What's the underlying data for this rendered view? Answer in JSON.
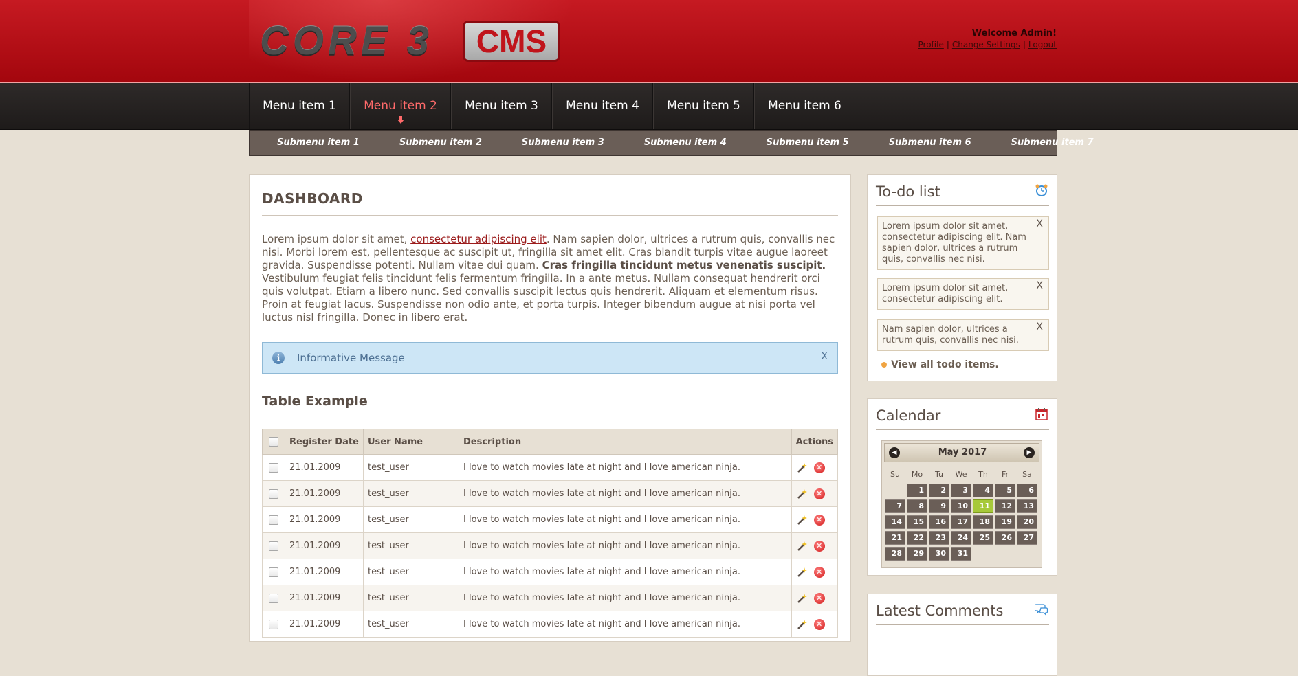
{
  "header": {
    "logo_main": "CORE 3",
    "logo_badge": "CMS",
    "welcome": "Welcome Admin!",
    "links": [
      "Profile",
      "Change Settings",
      "Logout"
    ]
  },
  "nav": {
    "items": [
      "Menu item 1",
      "Menu item 2",
      "Menu item 3",
      "Menu item 4",
      "Menu item 5",
      "Menu item 6"
    ],
    "active_index": 1
  },
  "subnav": {
    "items": [
      "Submenu item 1",
      "Submenu item 2",
      "Submenu item 3",
      "Submenu item 4",
      "Submenu item 5",
      "Submenu item 6",
      "Submenu item 7"
    ]
  },
  "main": {
    "title": "DASHBOARD",
    "intro_before_link": "Lorem ipsum dolor sit amet, ",
    "intro_link": "consectetur adipiscing elit",
    "intro_after_link": ". Nam sapien dolor, ultrices a rutrum quis, convallis nec nisi. Morbi lorem est, pellentesque ac suscipit ut, fringilla sit amet elit. Cras blandit turpis vitae augue laoreet gravida. Suspendisse potenti. Nullam vitae dui quam. ",
    "intro_bold": "Cras fringilla tincidunt metus venenatis suscipit.",
    "intro_end": " Vestibulum feugiat felis tincidunt felis fermentum fringilla. In a ante metus. Nullam consequat hendrerit orci quis volutpat. Etiam a libero nunc. Sed convallis suscipit lectus quis hendrerit. Aliquam et elementum risus. Proin at feugiat lacus. Suspendisse non odio ante, et porta turpis. Integer bibendum augue at nisi porta vel luctus nisl fringilla. Donec in libero erat.",
    "info_message": "Informative Message",
    "info_close": "X",
    "table_title": "Table Example",
    "table": {
      "headers": [
        "Register Date",
        "User Name",
        "Description",
        "Actions"
      ],
      "rows": [
        {
          "date": "21.01.2009",
          "user": "test_user",
          "desc": "I love to watch movies late at night and I love american ninja."
        },
        {
          "date": "21.01.2009",
          "user": "test_user",
          "desc": "I love to watch movies late at night and I love american ninja."
        },
        {
          "date": "21.01.2009",
          "user": "test_user",
          "desc": "I love to watch movies late at night and I love american ninja."
        },
        {
          "date": "21.01.2009",
          "user": "test_user",
          "desc": "I love to watch movies late at night and I love american ninja."
        },
        {
          "date": "21.01.2009",
          "user": "test_user",
          "desc": "I love to watch movies late at night and I love american ninja."
        },
        {
          "date": "21.01.2009",
          "user": "test_user",
          "desc": "I love to watch movies late at night and I love american ninja."
        },
        {
          "date": "21.01.2009",
          "user": "test_user",
          "desc": "I love to watch movies late at night and I love american ninja."
        }
      ]
    }
  },
  "sidebar": {
    "todo": {
      "title": "To-do list",
      "icon": "alarm-clock-icon",
      "items": [
        "Lorem ipsum dolor sit amet, consectetur adipiscing elit. Nam sapien dolor, ultrices a rutrum quis, convallis nec nisi.",
        "Lorem ipsum dolor sit amet, consectetur adipiscing elit.",
        "Nam sapien dolor, ultrices a rutrum quis, convallis nec nisi."
      ],
      "close": "X",
      "view_all": "View all todo items."
    },
    "calendar": {
      "title": "Calendar",
      "icon": "calendar-icon",
      "month": "May 2017",
      "weekdays": [
        "Su",
        "Mo",
        "Tu",
        "We",
        "Th",
        "Fr",
        "Sa"
      ],
      "days": [
        "1",
        "2",
        "3",
        "4",
        "5",
        "6",
        "7",
        "8",
        "9",
        "10",
        "11",
        "12",
        "13",
        "14",
        "15",
        "16",
        "17",
        "18",
        "19",
        "20",
        "21",
        "22",
        "23",
        "24",
        "25",
        "26",
        "27",
        "28",
        "29",
        "30",
        "31"
      ],
      "first_weekday_index": 1,
      "today": "11"
    },
    "comments": {
      "title": "Latest Comments",
      "icon": "speech-bubbles-icon"
    }
  },
  "colors": {
    "header_red": "#b30f16",
    "nav_dark": "#262221",
    "active_nav": "#ff6a6a",
    "page_bg": "#e7e0d4",
    "subnav": "#6a5e57",
    "info_bg": "#cde6f6",
    "today": "#a7c93a"
  }
}
